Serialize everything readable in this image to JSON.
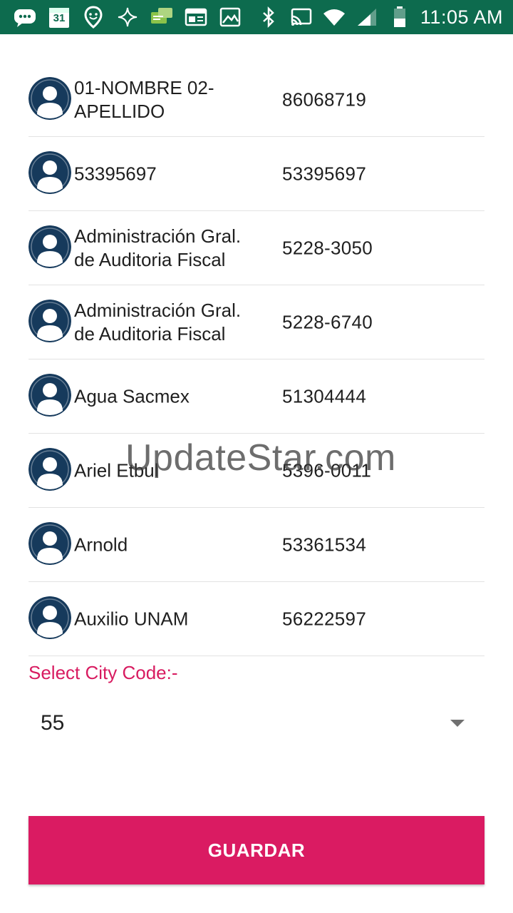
{
  "status_bar": {
    "time": "11:05 AM",
    "calendar_date": "31",
    "left_icons": [
      "message-icon",
      "calendar-icon",
      "location-icon",
      "sparkle-icon",
      "chat-icon",
      "news-icon",
      "gallery-icon"
    ],
    "right_icons": [
      "bluetooth-icon",
      "cast-icon",
      "wifi-icon",
      "signal-icon",
      "battery-icon"
    ],
    "background_color": "#0d6b4e"
  },
  "contacts": [
    {
      "name": "01-NOMBRE 02-APELLIDO",
      "phone": "86068719"
    },
    {
      "name": "53395697",
      "phone": "53395697"
    },
    {
      "name": "Administración Gral. de Auditoria Fiscal",
      "phone": "5228-3050"
    },
    {
      "name": "Administración Gral. de Auditoria Fiscal",
      "phone": "5228-6740"
    },
    {
      "name": "Agua Sacmex",
      "phone": "51304444"
    },
    {
      "name": "Ariel Etbul",
      "phone": "5396-0011"
    },
    {
      "name": "Arnold",
      "phone": "53361534"
    },
    {
      "name": "Auxilio UNAM",
      "phone": "56222597"
    }
  ],
  "city": {
    "label": "Select City Code:-",
    "selected": "55"
  },
  "save_button": {
    "label": "GUARDAR",
    "color": "#da1b62"
  },
  "watermark": "UpdateStar.com",
  "colors": {
    "accent": "#d81b60",
    "avatar": "#163a5c"
  }
}
